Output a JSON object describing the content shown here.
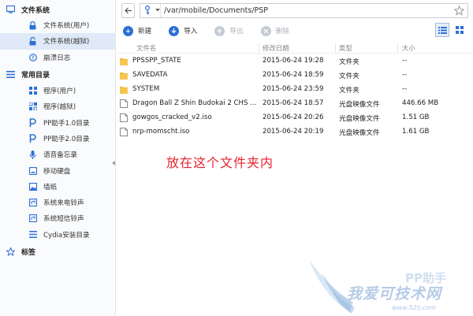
{
  "sidebar": {
    "file_system": {
      "label": "文件系统",
      "items": [
        {
          "label": "文件系统(用户)",
          "icon": "lock-icon"
        },
        {
          "label": "文件系统(越狱)",
          "icon": "unlock-icon",
          "active": true
        },
        {
          "label": "崩溃日志",
          "icon": "alert-icon"
        }
      ]
    },
    "common": {
      "label": "常用目录",
      "items": [
        {
          "label": "程序(用户)",
          "icon": "apps-icon"
        },
        {
          "label": "程序(越狱)",
          "icon": "apps-icon"
        },
        {
          "label": "PP助手1.0目录",
          "icon": "pp-icon"
        },
        {
          "label": "PP助手2.0目录",
          "icon": "pp-icon"
        },
        {
          "label": "语音备忘录",
          "icon": "mic-icon"
        },
        {
          "label": "移动硬盘",
          "icon": "drive-icon"
        },
        {
          "label": "墙纸",
          "icon": "image-icon"
        },
        {
          "label": "系统来电铃声",
          "icon": "bell-icon"
        },
        {
          "label": "系统短信铃声",
          "icon": "bell-icon"
        },
        {
          "label": "Cydia安装目录",
          "icon": "list-icon"
        }
      ]
    },
    "bookmarks": {
      "label": "标签"
    }
  },
  "address": {
    "path": "/var/mobile/Documents/PSP"
  },
  "toolbar": {
    "new_label": "新建",
    "import_label": "导入",
    "export_label": "导出",
    "delete_label": "删除"
  },
  "columns": {
    "name": "文件名",
    "date": "修改日期",
    "type": "类型",
    "size": "大小"
  },
  "files": [
    {
      "name": "PPSSPP_STATE",
      "date": "2015-06-24 19:28",
      "type": "文件夹",
      "size": "--",
      "kind": "folder"
    },
    {
      "name": "SAVEDATA",
      "date": "2015-06-24 18:59",
      "type": "文件夹",
      "size": "--",
      "kind": "folder"
    },
    {
      "name": "SYSTEM",
      "date": "2015-06-24 23:59",
      "type": "文件夹",
      "size": "--",
      "kind": "folder"
    },
    {
      "name": "Dragon Ball Z  Shin Budokai 2 CHS ...",
      "date": "2015-06-24 18:57",
      "type": "光盘映像文件",
      "size": "446.66 MB",
      "kind": "file"
    },
    {
      "name": "gowgos_cracked_v2.iso",
      "date": "2015-06-24 20:26",
      "type": "光盘映像文件",
      "size": "1.51 GB",
      "kind": "file"
    },
    {
      "name": "nrp-momscht.iso",
      "date": "2015-06-24 20:19",
      "type": "光盘映像文件",
      "size": "1.61 GB",
      "kind": "file"
    }
  ],
  "annotation": "放在这个文件夹内",
  "watermark": {
    "text": "我爱可技术网",
    "url": "www.52ij.com",
    "logo": "PP助手"
  },
  "colors": {
    "accent": "#2d6fd6",
    "annotation": "#e8222e",
    "folder": "#f3b73a",
    "active_bg": "#dfe9f7"
  }
}
